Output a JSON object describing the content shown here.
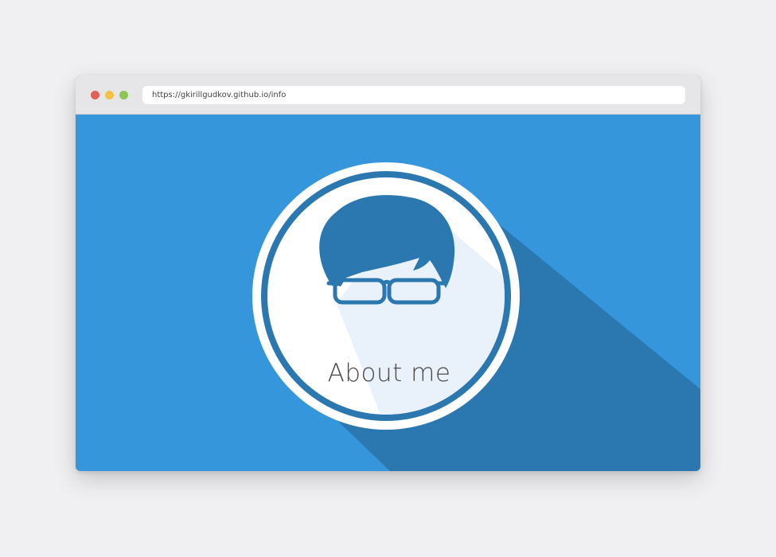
{
  "browser": {
    "url": "https://gkirillgudkov.github.io/info",
    "traffic_lights": {
      "close": "#e0605a",
      "minimize": "#f3c243",
      "maximize": "#8ec453"
    }
  },
  "page": {
    "background_color": "#3596dc",
    "shadow_color": "#2b78b0",
    "avatar_icon": "face-with-glasses-icon",
    "heading": "About me"
  }
}
